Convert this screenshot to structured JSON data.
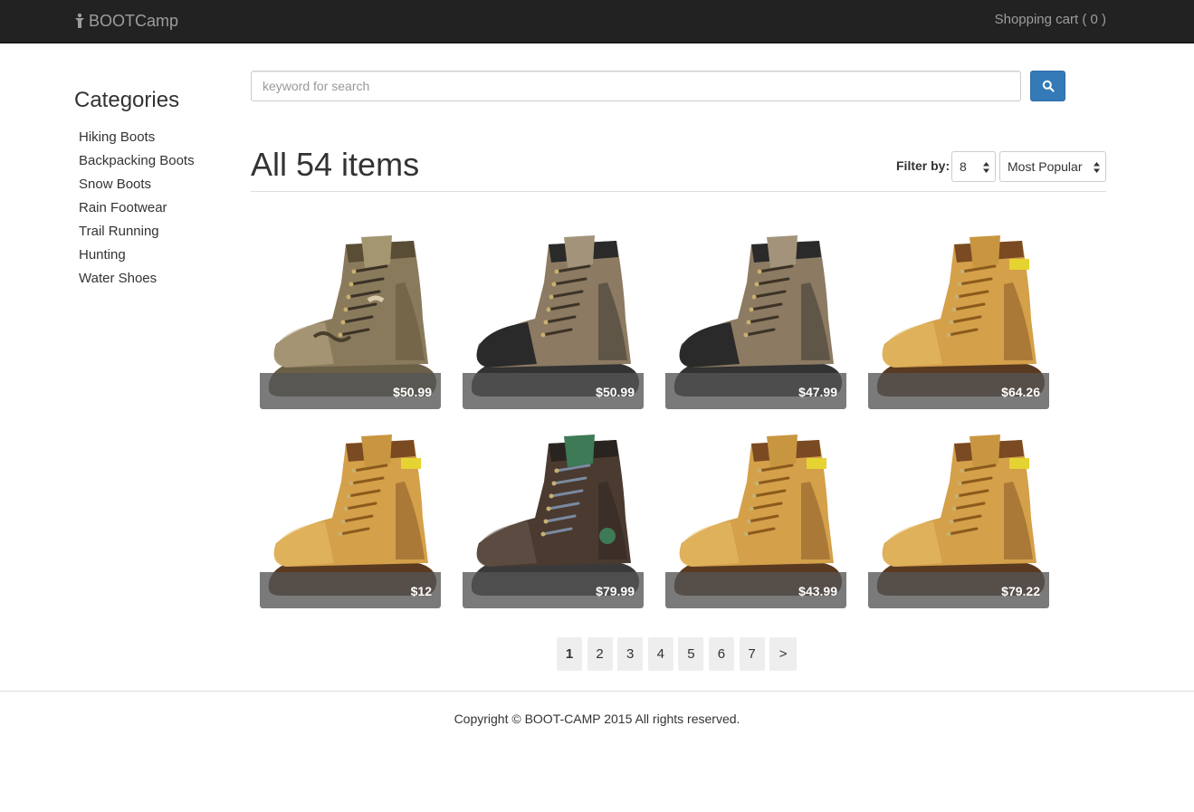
{
  "navbar": {
    "brand": "BOOTCamp",
    "cart": "Shopping cart ( 0 )"
  },
  "sidebar": {
    "title": "Categories",
    "items": [
      "Hiking Boots",
      "Backpacking Boots",
      "Snow Boots",
      "Rain Footwear",
      "Trail Running",
      "Hunting",
      "Water Shoes"
    ]
  },
  "search": {
    "placeholder": "keyword for search",
    "value": ""
  },
  "listing": {
    "title": "All 54 items",
    "filter_label": "Filter by:",
    "per_page": "8",
    "sort": "Most Popular"
  },
  "products": [
    {
      "price": "$50.99",
      "style": "camo"
    },
    {
      "price": "$50.99",
      "style": "hiker"
    },
    {
      "price": "$47.99",
      "style": "hiker"
    },
    {
      "price": "$64.26",
      "style": "work"
    },
    {
      "price": "$12",
      "style": "work"
    },
    {
      "price": "$79.99",
      "style": "brown"
    },
    {
      "price": "$43.99",
      "style": "work"
    },
    {
      "price": "$79.22",
      "style": "work"
    }
  ],
  "pagination": {
    "pages": [
      "1",
      "2",
      "3",
      "4",
      "5",
      "6",
      "7"
    ],
    "next": ">",
    "current": "1"
  },
  "footer": {
    "copyright": "Copyright © BOOT-CAMP 2015 All rights reserved."
  },
  "colors": {
    "navbar": "#222222",
    "primary": "#337ab7",
    "price_overlay": "#555555"
  }
}
